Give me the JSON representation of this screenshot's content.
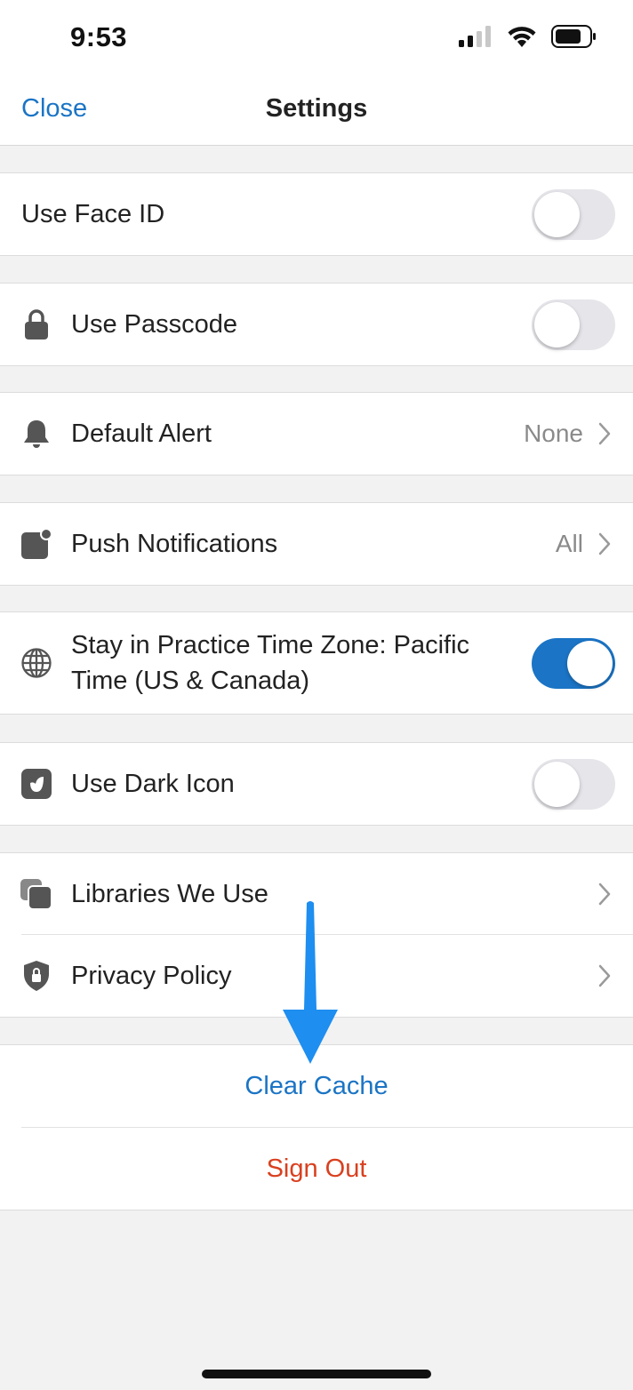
{
  "status_bar": {
    "time": "9:53",
    "icons": [
      "cellular-signal-icon",
      "wifi-icon",
      "battery-icon"
    ]
  },
  "nav": {
    "close_label": "Close",
    "title": "Settings"
  },
  "settings": {
    "face_id": {
      "label": "Use Face ID",
      "enabled": false
    },
    "passcode": {
      "label": "Use Passcode",
      "icon": "lock-icon",
      "enabled": false
    },
    "default_alert": {
      "label": "Default Alert",
      "icon": "bell-icon",
      "value": "None"
    },
    "push_notifications": {
      "label": "Push Notifications",
      "icon": "notification-badge-icon",
      "value": "All"
    },
    "time_zone": {
      "label": "Stay in Practice Time Zone: Pacific Time (US & Canada)",
      "icon": "globe-icon",
      "enabled": true
    },
    "dark_icon": {
      "label": "Use Dark Icon",
      "icon": "app-icon",
      "enabled": false
    },
    "libraries": {
      "label": "Libraries We Use",
      "icon": "stacked-squares-icon"
    },
    "privacy": {
      "label": "Privacy Policy",
      "icon": "shield-lock-icon"
    }
  },
  "actions": {
    "clear_cache": "Clear Cache",
    "sign_out": "Sign Out"
  },
  "colors": {
    "accent": "#1b74c5",
    "destructive": "#d9401f",
    "annotation_arrow": "#1e8ef0",
    "toggle_off": "#e5e5ea",
    "background": "#f2f2f2"
  }
}
